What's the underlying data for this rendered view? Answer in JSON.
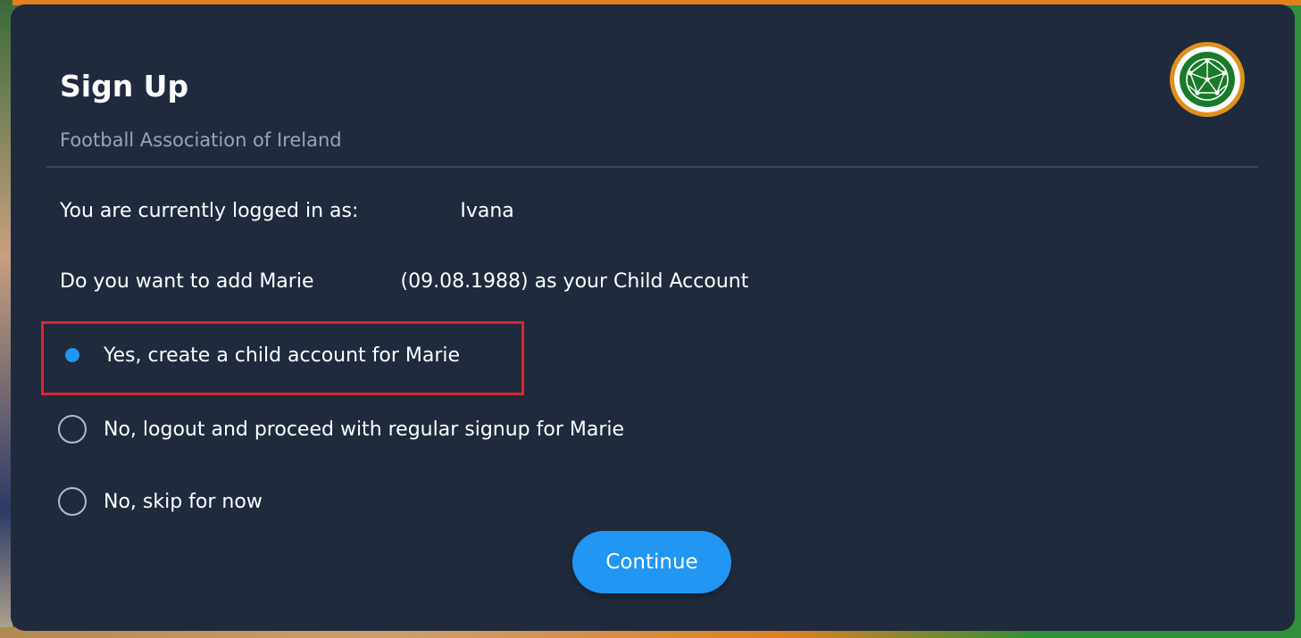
{
  "dialog": {
    "title": "Sign Up",
    "subtitle": "Football Association of Ireland",
    "logo_icon": "fai-crest-icon"
  },
  "session": {
    "logged_in_prefix": "You are currently logged in as:",
    "logged_in_name": "Ivana"
  },
  "question": {
    "prefix": "Do you want to add Marie",
    "suffix": "(09.08.1988) as your Child Account"
  },
  "options": [
    {
      "label": "Yes, create a child account for Marie",
      "selected": true
    },
    {
      "label": "No, logout and proceed with regular signup for Marie",
      "selected": false
    },
    {
      "label": "No, skip for now",
      "selected": false
    }
  ],
  "continue_label": "Continue",
  "colors": {
    "panel_bg": "#1f2a3d",
    "accent": "#2196f3",
    "highlight_border": "#e0242e",
    "subtitle": "#9aa4b4"
  }
}
